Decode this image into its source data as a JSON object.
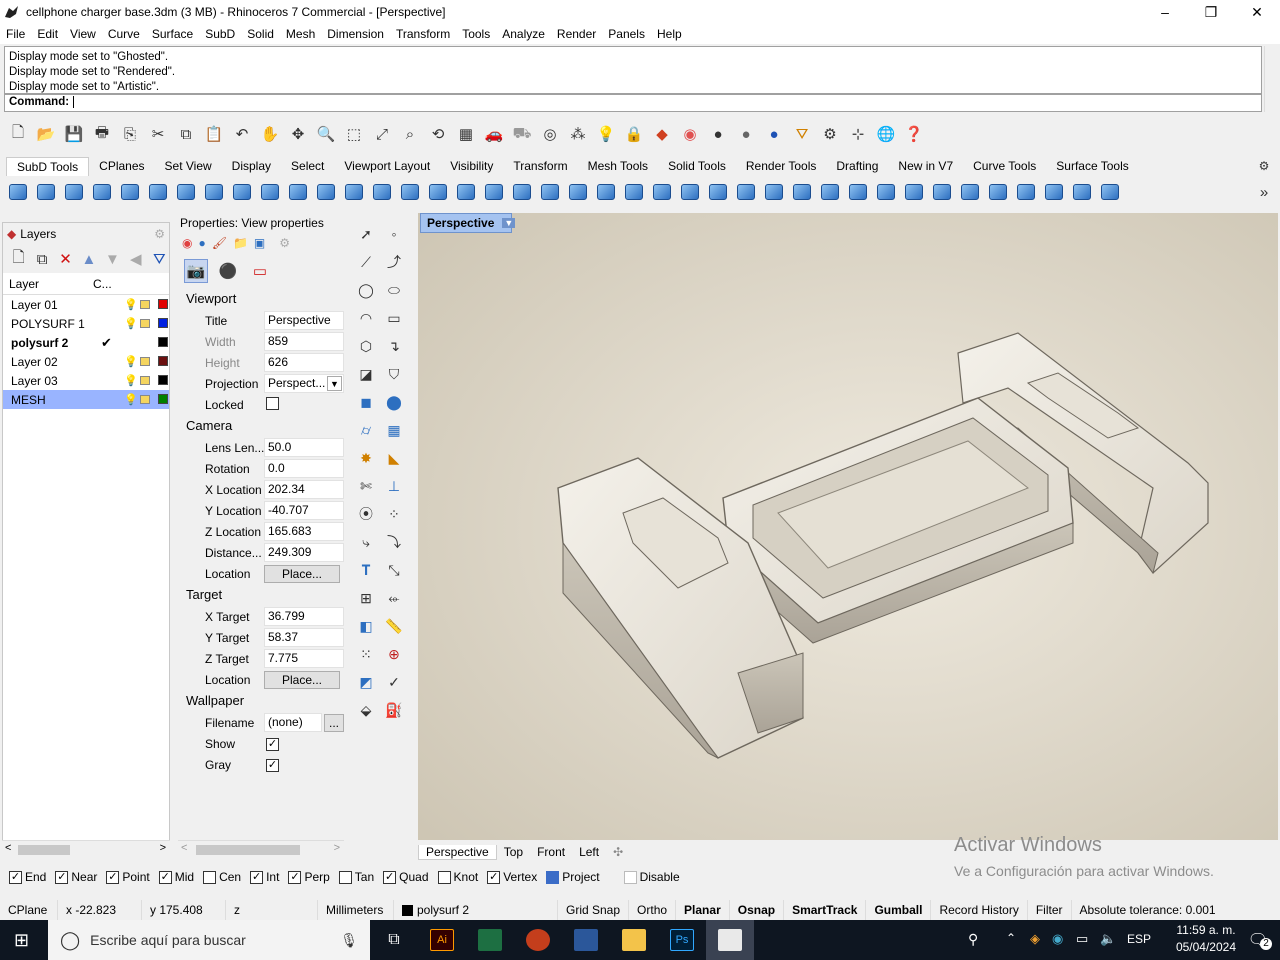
{
  "window": {
    "title": "cellphone charger base.3dm (3 MB) - Rhinoceros 7 Commercial - [Perspective]"
  },
  "menu": [
    "File",
    "Edit",
    "View",
    "Curve",
    "Surface",
    "SubD",
    "Solid",
    "Mesh",
    "Dimension",
    "Transform",
    "Tools",
    "Analyze",
    "Render",
    "Panels",
    "Help"
  ],
  "command": {
    "history": [
      "Display mode set to \"Ghosted\".",
      "Display mode set to \"Rendered\".",
      "Display mode set to \"Artistic\"."
    ],
    "prompt": "Command:"
  },
  "toolbar_tabs": [
    "SubD Tools",
    "CPlanes",
    "Set View",
    "Display",
    "Select",
    "Viewport Layout",
    "Visibility",
    "Transform",
    "Mesh Tools",
    "Solid Tools",
    "Render Tools",
    "Drafting",
    "New in V7",
    "Curve Tools",
    "Surface Tools"
  ],
  "layers": {
    "title": "Layers",
    "col_layer": "Layer",
    "col_c": "C...",
    "rows": [
      {
        "name": "Layer 01",
        "color": "#e00000"
      },
      {
        "name": "POLYSURF 1",
        "color": "#0020e0"
      },
      {
        "name": "polysurf 2",
        "color": "#000000",
        "current": "✔"
      },
      {
        "name": "Layer 02",
        "color": "#6b1010"
      },
      {
        "name": "Layer 03",
        "color": "#000000"
      },
      {
        "name": "MESH",
        "color": "#008000"
      }
    ]
  },
  "props": {
    "title": "Properties: View properties",
    "viewport": {
      "label": "Viewport",
      "title_lbl": "Title",
      "title": "Perspective",
      "width_lbl": "Width",
      "width": "859",
      "height_lbl": "Height",
      "height": "626",
      "proj_lbl": "Projection",
      "proj": "Perspect...",
      "locked_lbl": "Locked"
    },
    "camera": {
      "label": "Camera",
      "lens_lbl": "Lens Len...",
      "lens": "50.0",
      "rot_lbl": "Rotation",
      "rot": "0.0",
      "xl_lbl": "X Location",
      "xl": "202.34",
      "yl_lbl": "Y Location",
      "yl": "-40.707",
      "zl_lbl": "Z Location",
      "zl": "165.683",
      "dist_lbl": "Distance...",
      "dist": "249.309",
      "loc_lbl": "Location",
      "loc_btn": "Place..."
    },
    "target": {
      "label": "Target",
      "xt_lbl": "X Target",
      "xt": "36.799",
      "yt_lbl": "Y Target",
      "yt": "58.37",
      "zt_lbl": "Z Target",
      "zt": "7.775",
      "loc_lbl": "Location",
      "loc_btn": "Place..."
    },
    "wallpaper": {
      "label": "Wallpaper",
      "file_lbl": "Filename",
      "file": "(none)",
      "file_btn": "...",
      "show_lbl": "Show",
      "gray_lbl": "Gray"
    }
  },
  "viewport": {
    "active_tab": "Perspective",
    "tabs": [
      "Perspective",
      "Top",
      "Front",
      "Left"
    ],
    "add": "✣"
  },
  "osnap": [
    {
      "label": "End",
      "checked": true
    },
    {
      "label": "Near",
      "checked": true
    },
    {
      "label": "Point",
      "checked": true
    },
    {
      "label": "Mid",
      "checked": true
    },
    {
      "label": "Cen",
      "checked": false
    },
    {
      "label": "Int",
      "checked": true
    },
    {
      "label": "Perp",
      "checked": true
    },
    {
      "label": "Tan",
      "checked": false
    },
    {
      "label": "Quad",
      "checked": true
    },
    {
      "label": "Knot",
      "checked": false
    },
    {
      "label": "Vertex",
      "checked": true
    },
    {
      "label": "Project",
      "checked": true
    },
    {
      "label": "Disable",
      "checked": false
    }
  ],
  "status": {
    "cplane": "CPlane",
    "x": "x -22.823",
    "y": "y 175.408",
    "z": "z",
    "units": "Millimeters",
    "layer": "polysurf 2",
    "gridsnap": "Grid Snap",
    "ortho": "Ortho",
    "planar": "Planar",
    "osnap": "Osnap",
    "smarttrack": "SmartTrack",
    "gumball": "Gumball",
    "history": "Record History",
    "filter": "Filter",
    "tolerance": "Absolute tolerance: 0.001"
  },
  "watermark": {
    "title": "Activar Windows",
    "sub": "Ve a Configuración para activar Windows."
  },
  "taskbar": {
    "search": "Escribe aquí para buscar",
    "lang": "ESP",
    "time": "11:59 a. m.",
    "date": "05/04/2024",
    "notif": "2"
  }
}
